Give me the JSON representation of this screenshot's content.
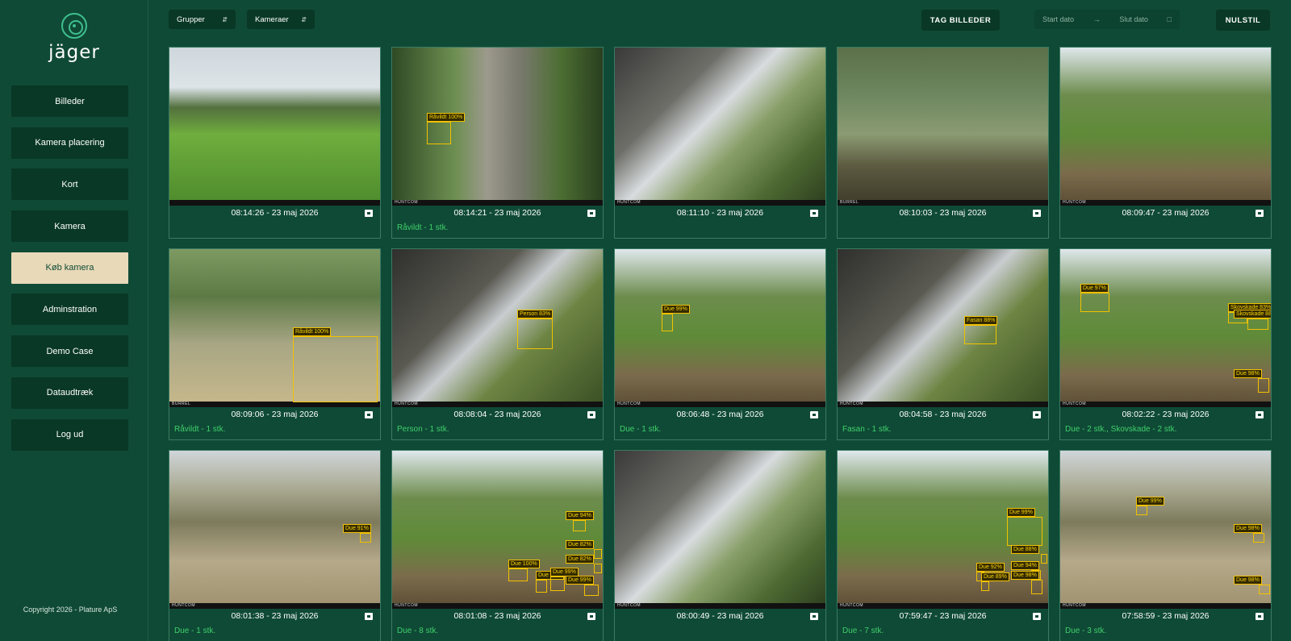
{
  "app": {
    "logo_text": "jäger",
    "copyright": "Copyright 2026 - Plature ApS"
  },
  "sidebar": {
    "items": [
      {
        "label": "Billeder"
      },
      {
        "label": "Kamera placering"
      },
      {
        "label": "Kort"
      },
      {
        "label": "Kamera"
      },
      {
        "label": "Køb kamera",
        "active": true
      },
      {
        "label": "Adminstration"
      },
      {
        "label": "Demo Case"
      },
      {
        "label": "Dataudtræk"
      },
      {
        "label": "Log ud"
      }
    ]
  },
  "toolbar": {
    "groups_label": "Grupper",
    "cameras_label": "Kameraer",
    "take_photos_label": "TAG BILLEDER",
    "start_date_placeholder": "Start dato",
    "end_date_placeholder": "Slut dato",
    "reset_label": "NULSTIL"
  },
  "gallery": {
    "cards": [
      {
        "time": "08:14:26 - 23 maj 2026",
        "detections": "",
        "scene": "field",
        "strip": "",
        "boxes": []
      },
      {
        "time": "08:14:21 - 23 maj 2026",
        "detections": "Råvildt - 1 stk.",
        "scene": "road",
        "strip": "HUNTCOM",
        "boxes": [
          {
            "label": "Råvildt 100%"
          }
        ]
      },
      {
        "time": "08:11:10 - 23 maj 2026",
        "detections": "",
        "scene": "feeder",
        "strip": "HUNTCOM",
        "boxes": []
      },
      {
        "time": "08:10:03 - 23 maj 2026",
        "detections": "",
        "scene": "forest",
        "strip": "BURREL",
        "boxes": []
      },
      {
        "time": "08:09:47 - 23 maj 2026",
        "detections": "",
        "scene": "clear",
        "strip": "HUNTCOM",
        "boxes": []
      },
      {
        "time": "08:09:06 - 23 maj 2026",
        "detections": "Råvildt - 1 stk.",
        "scene": "deer",
        "strip": "BURREL",
        "boxes": [
          {
            "label": "Råvildt 100%"
          }
        ]
      },
      {
        "time": "08:08:04 - 23 maj 2026",
        "detections": "Person - 1 stk.",
        "scene": "dark",
        "strip": "HUNTCOM",
        "boxes": [
          {
            "label": "Person 83%"
          }
        ]
      },
      {
        "time": "08:06:48 - 23 maj 2026",
        "detections": "Due - 1 stk.",
        "scene": "clear",
        "strip": "HUNTCOM",
        "boxes": [
          {
            "label": "Due 99%"
          }
        ]
      },
      {
        "time": "08:04:58 - 23 maj 2026",
        "detections": "Fasan - 1 stk.",
        "scene": "dark",
        "strip": "HUNTCOM",
        "boxes": [
          {
            "label": "Fasan 88%"
          }
        ]
      },
      {
        "time": "08:02:22 - 23 maj 2026",
        "detections": "Due - 2 stk., Skovskade - 2 stk.",
        "scene": "clear",
        "strip": "HUNTCOM",
        "boxes": [
          {
            "label": "Due 97%"
          },
          {
            "label": "Skovskade 83%"
          },
          {
            "label": "Skovskade 88"
          },
          {
            "label": "Due 98%"
          }
        ]
      },
      {
        "time": "08:01:38 - 23 maj 2026",
        "detections": "Due - 1 stk.",
        "scene": "bare",
        "strip": "HUNTCOM",
        "boxes": [
          {
            "label": "Due 91%"
          }
        ]
      },
      {
        "time": "08:01:08 - 23 maj 2026",
        "detections": "Due - 8 stk.",
        "scene": "clear",
        "strip": "HUNTCOM",
        "boxes": [
          {
            "label": "Due 94%"
          },
          {
            "label": "Due 82%"
          },
          {
            "label": "Due 82%"
          },
          {
            "label": "Due 99%"
          },
          {
            "label": "Due 100%"
          },
          {
            "label": "Due 96%"
          },
          {
            "label": "Due 99%"
          }
        ]
      },
      {
        "time": "08:00:49 - 23 maj 2026",
        "detections": "",
        "scene": "feeder",
        "strip": "HUNTCOM",
        "boxes": []
      },
      {
        "time": "07:59:47 - 23 maj 2026",
        "detections": "Due - 7 stk.",
        "scene": "clear",
        "strip": "HUNTCOM",
        "boxes": [
          {
            "label": "Due 99%"
          },
          {
            "label": "Due 88%"
          },
          {
            "label": "Due 94%"
          },
          {
            "label": "Due 92%"
          },
          {
            "label": "Due 89%"
          },
          {
            "label": "Due 98%"
          }
        ]
      },
      {
        "time": "07:58:59 - 23 maj 2026",
        "detections": "Due - 3 stk.",
        "scene": "bare",
        "strip": "HUNTCOM",
        "boxes": [
          {
            "label": "Due 99%"
          },
          {
            "label": "Due 98%"
          },
          {
            "label": "Due 98%"
          }
        ]
      }
    ]
  },
  "colors": {
    "background": "#0f4a36",
    "nav_button": "#093826",
    "nav_active": "#e8d9b8",
    "detection_text": "#3fcf6a",
    "bbox": "#f2c200"
  }
}
